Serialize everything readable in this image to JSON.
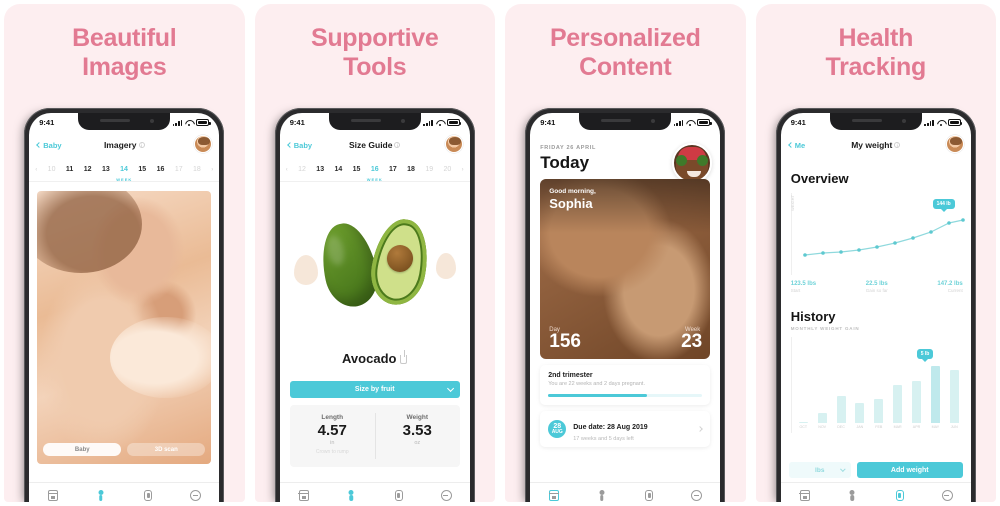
{
  "panels": [
    {
      "title_line1": "Beautiful",
      "title_line2": "Images"
    },
    {
      "title_line1": "Supportive",
      "title_line2": "Tools"
    },
    {
      "title_line1": "Personalized",
      "title_line2": "Content"
    },
    {
      "title_line1": "Health",
      "title_line2": "Tracking"
    }
  ],
  "status": {
    "time": "9:41"
  },
  "colors": {
    "brand_pink": "#e27a92",
    "panel_bg": "#fdeef0",
    "teal": "#4cc9d8"
  },
  "screen1": {
    "back_label": "Baby",
    "title": "Imagery",
    "weeks": [
      "‹",
      "10",
      "11",
      "12",
      "13",
      "14",
      "15",
      "16",
      "17",
      "18",
      "›"
    ],
    "active_week": "14",
    "week_caption": "WEEK",
    "segment_left": "Baby",
    "segment_right": "3D scan"
  },
  "screen2": {
    "back_label": "Baby",
    "title": "Size Guide",
    "weeks": [
      "‹",
      "12",
      "13",
      "14",
      "15",
      "16",
      "17",
      "18",
      "19",
      "20",
      "›"
    ],
    "active_week": "16",
    "week_caption": "WEEK",
    "fruit_name": "Avocado",
    "dropdown_label": "Size by fruit",
    "metrics": [
      {
        "label": "Length",
        "value": "4.57",
        "unit": "in",
        "sub": "Crown to rump"
      },
      {
        "label": "Weight",
        "value": "3.53",
        "unit": "oz",
        "sub": ""
      }
    ]
  },
  "screen3": {
    "date": "FRIDAY 26 APRIL",
    "heading": "Today",
    "greeting": "Good morning,",
    "name": "Sophia",
    "day_label": "Day",
    "day_value": "156",
    "week_label": "Week",
    "week_value": "23",
    "trimester_title": "2nd trimester",
    "trimester_sub": "You are 22 weeks and 2 days pregnant.",
    "due_day": "28",
    "due_month": "AUG",
    "due_title": "Due date: 28 Aug 2019",
    "due_sub": "17 weeks and 5 days left"
  },
  "screen4": {
    "back_label": "Me",
    "title": "My weight",
    "overview_heading": "Overview",
    "history_heading": "History",
    "history_sub": "MONTHLY WEIGHT GAIN",
    "y_axis_label": "WEIGHT",
    "line_tooltip": "144 lb",
    "bar_tooltip": "5 lb",
    "stats": [
      {
        "value": "123.5 lbs",
        "key": "Start"
      },
      {
        "value": "22.5 lbs",
        "key": "Gain so far"
      },
      {
        "value": "147.2 lbs",
        "key": "Current"
      }
    ],
    "unit_label": "lbs",
    "add_button": "Add weight"
  },
  "chart_data": [
    {
      "type": "line",
      "title": "Overview",
      "xlabel": "",
      "ylabel": "WEIGHT",
      "x": [
        1,
        2,
        3,
        4,
        5,
        6,
        7,
        8,
        9,
        10
      ],
      "values": [
        124,
        125,
        126,
        128,
        130,
        132,
        135,
        138,
        143,
        147
      ],
      "ylim": [
        120,
        150
      ],
      "annotation": "144 lb",
      "grid": false,
      "legend": "none"
    },
    {
      "type": "bar",
      "title": "History",
      "subtitle": "MONTHLY WEIGHT GAIN",
      "categories": [
        "OCT",
        "NOV",
        "DEC",
        "JAN",
        "FEB",
        "MAR",
        "APR",
        "MAY",
        "JUN"
      ],
      "values": [
        0,
        1.2,
        3.2,
        2.4,
        2.8,
        4.4,
        4.9,
        6.6,
        6.2
      ],
      "ylabel": "",
      "ylim": [
        0,
        7
      ],
      "annotation": "5 lb",
      "grid": false,
      "legend": "none"
    }
  ],
  "tabbar": {
    "items": [
      {
        "name": "calendar",
        "active": false
      },
      {
        "name": "baby",
        "active": false
      },
      {
        "name": "bottle",
        "active": false
      },
      {
        "name": "more",
        "active": false
      }
    ]
  }
}
